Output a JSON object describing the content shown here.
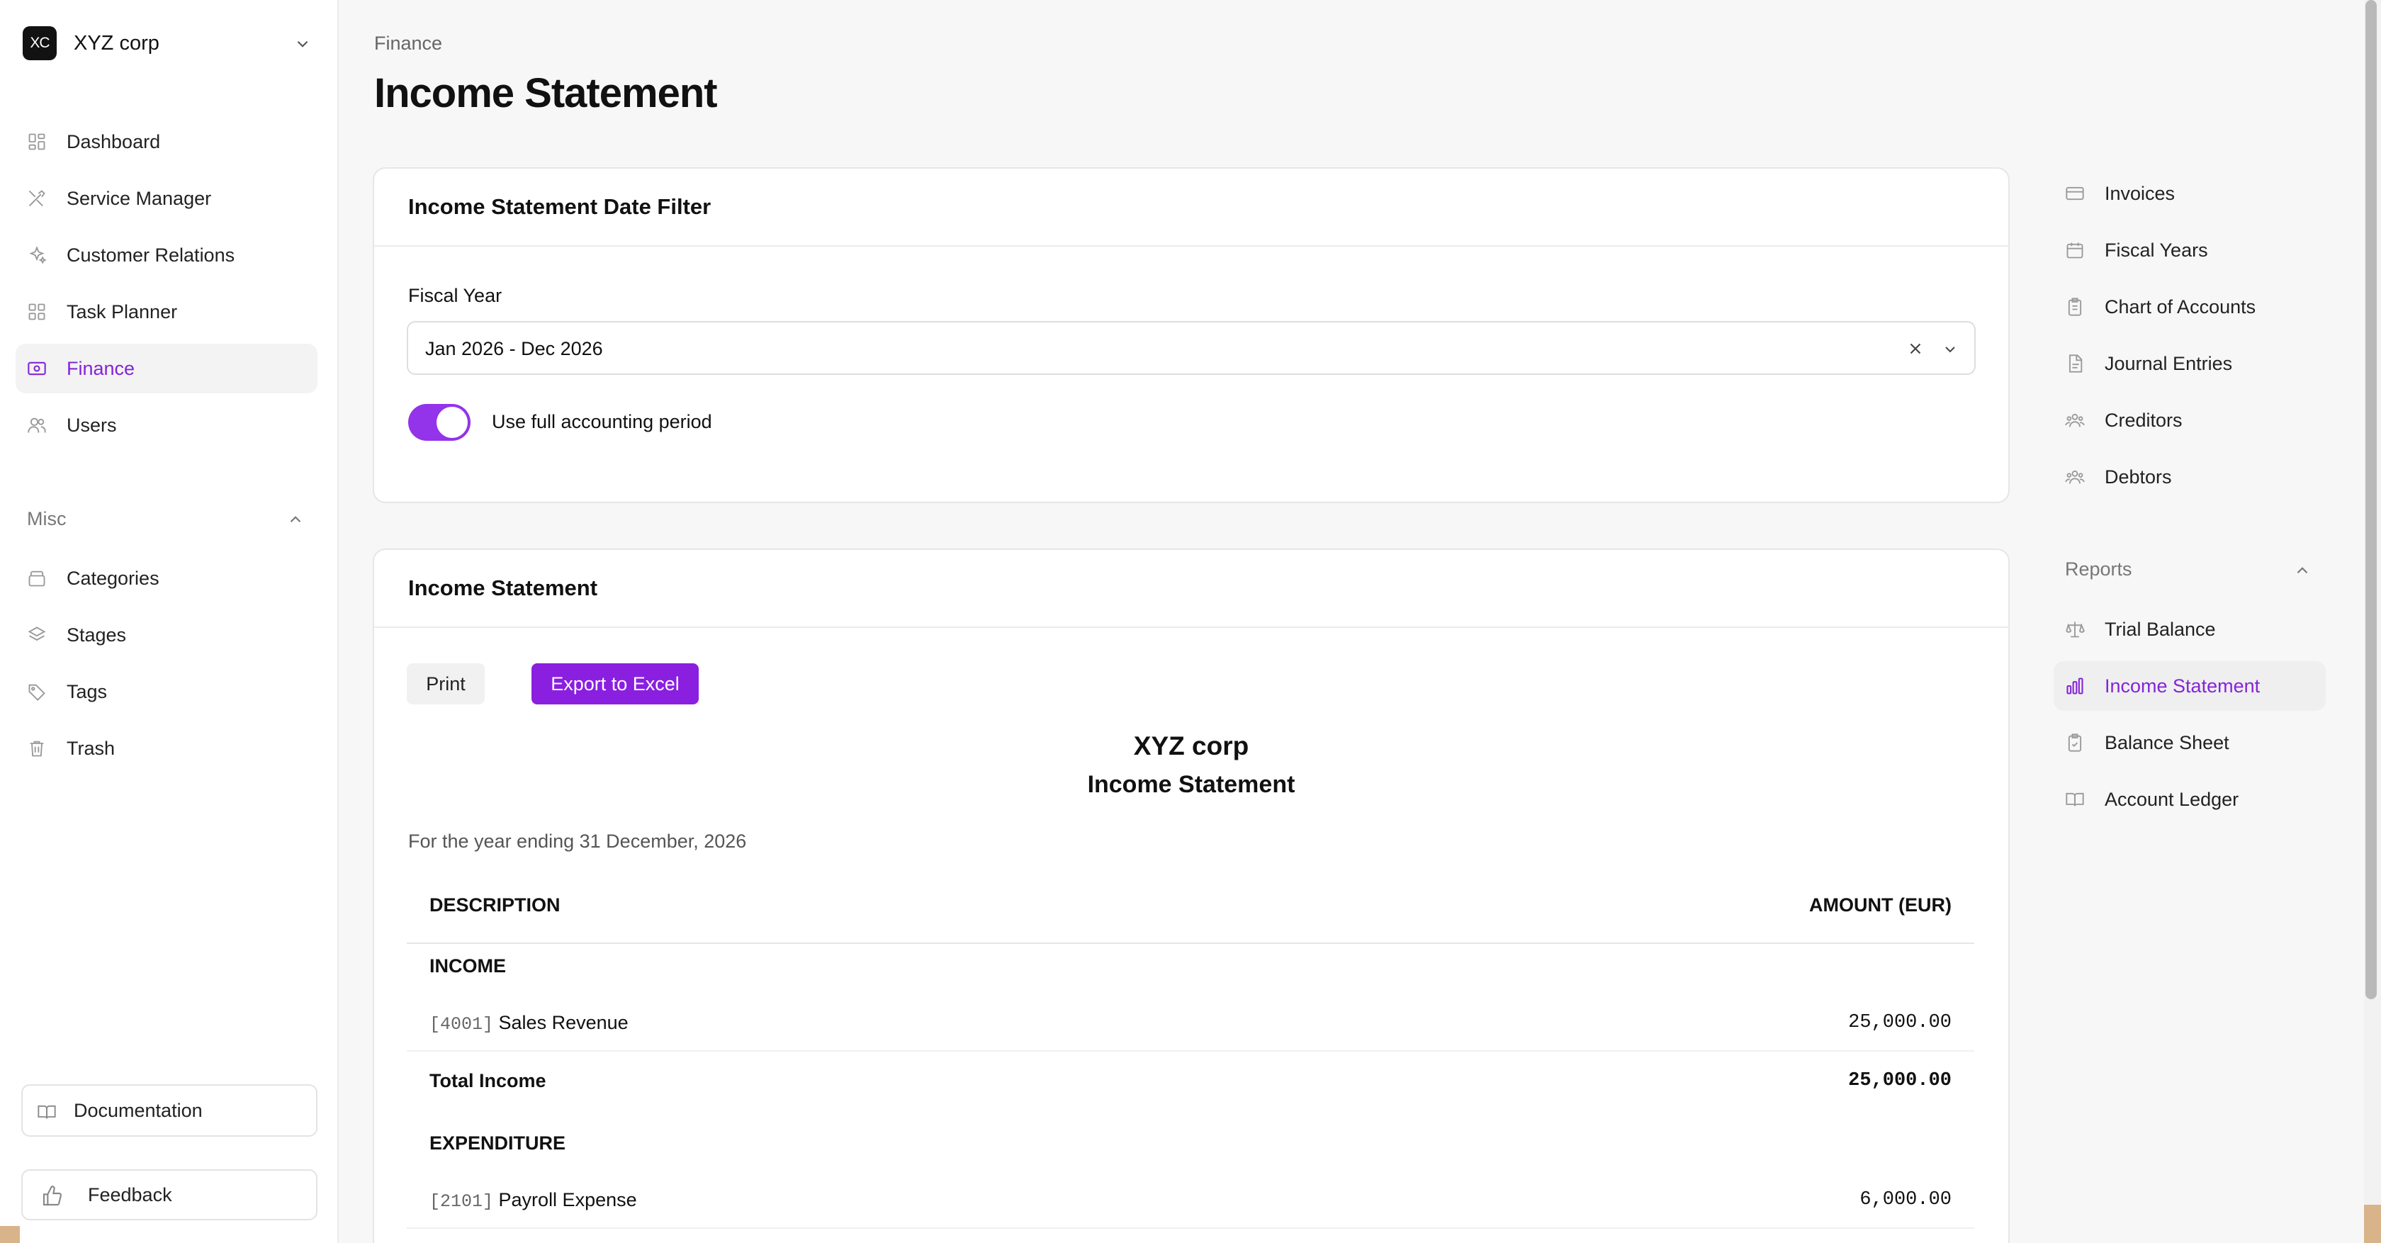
{
  "org": {
    "initials": "XC",
    "name": "XYZ corp"
  },
  "sidebar": {
    "items": [
      {
        "label": "Dashboard"
      },
      {
        "label": "Service Manager"
      },
      {
        "label": "Customer Relations"
      },
      {
        "label": "Task Planner"
      },
      {
        "label": "Finance"
      },
      {
        "label": "Users"
      }
    ],
    "misc_label": "Misc",
    "misc_items": [
      {
        "label": "Categories"
      },
      {
        "label": "Stages"
      },
      {
        "label": "Tags"
      },
      {
        "label": "Trash"
      }
    ],
    "documentation": "Documentation",
    "feedback": "Feedback"
  },
  "header": {
    "breadcrumb": "Finance",
    "title": "Income Statement"
  },
  "filter": {
    "title": "Income Statement Date Filter",
    "fiscal_year_label": "Fiscal Year",
    "fiscal_year_value": "Jan 2026 - Dec 2026",
    "toggle_label": "Use full accounting period",
    "toggle_on": true
  },
  "statement": {
    "card_title": "Income Statement",
    "print_label": "Print",
    "export_label": "Export to Excel",
    "company": "XYZ corp",
    "title": "Income Statement",
    "period": "For the year ending 31 December, 2026",
    "col_description": "DESCRIPTION",
    "col_amount": "AMOUNT (EUR)",
    "income_heading": "INCOME",
    "income_rows": [
      {
        "code": "[4001]",
        "name": "Sales Revenue",
        "amount": "25,000.00"
      }
    ],
    "total_income_label": "Total Income",
    "total_income": "25,000.00",
    "expenditure_heading": "EXPENDITURE",
    "expenditure_rows": [
      {
        "code": "[2101]",
        "name": "Payroll Expense",
        "amount": "6,000.00"
      }
    ]
  },
  "right_nav": {
    "items": [
      {
        "label": "Invoices"
      },
      {
        "label": "Fiscal Years"
      },
      {
        "label": "Chart of Accounts"
      },
      {
        "label": "Journal Entries"
      },
      {
        "label": "Creditors"
      },
      {
        "label": "Debtors"
      }
    ],
    "reports_label": "Reports",
    "reports": [
      {
        "label": "Trial Balance"
      },
      {
        "label": "Income Statement"
      },
      {
        "label": "Balance Sheet"
      },
      {
        "label": "Account Ledger"
      }
    ]
  },
  "colors": {
    "accent": "#8a1fe0",
    "active_text": "#8424d8",
    "background": "#f7f7f7"
  }
}
